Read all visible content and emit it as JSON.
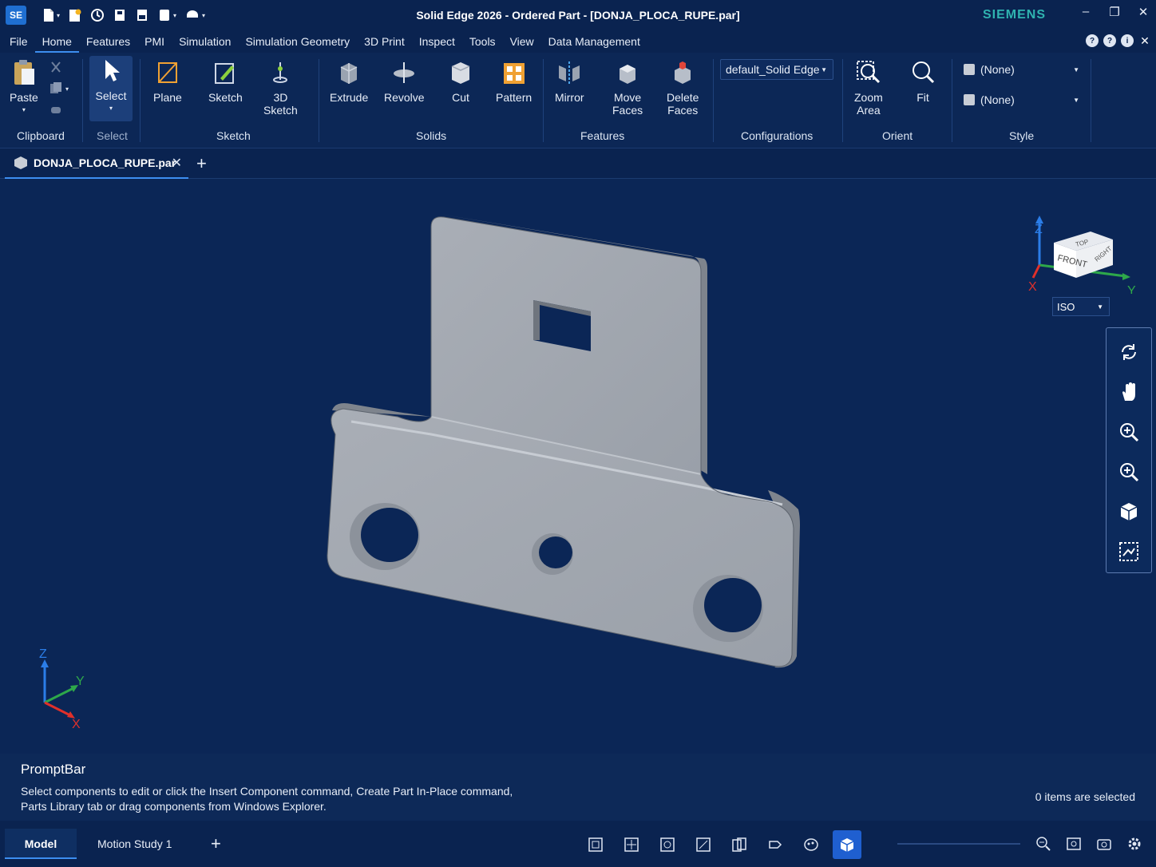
{
  "app": {
    "logo": "SE",
    "title": "Solid Edge 2026 - Ordered Part - [DONJA_PLOCA_RUPE.par]",
    "brand": "SIEMENS"
  },
  "quick_access": [
    "new-icon",
    "open-icon",
    "save-icon",
    "save-as-icon",
    "print-icon",
    "undo-icon",
    "redo-icon"
  ],
  "window_controls": {
    "minimize": "–",
    "restore": "❐",
    "close": "✕"
  },
  "menu": {
    "items": [
      "File",
      "Home",
      "Features",
      "PMI",
      "Simulation",
      "Simulation Geometry",
      "3D Print",
      "Inspect",
      "Tools",
      "View",
      "Data Management"
    ],
    "active": "Home"
  },
  "ribbon": {
    "paste": "Paste",
    "select": "Select",
    "plane": "Plane",
    "sketch": "Sketch",
    "sketch3d": "3D\nSketch",
    "extrude": "Extrude",
    "revolve": "Revolve",
    "cut": "Cut",
    "pattern": "Pattern",
    "mirror": "Mirror",
    "move_faces": "Move\nFaces",
    "delete_faces": "Delete\nFaces",
    "config_value": "default_Solid Edge",
    "zoom_area": "Zoom\nArea",
    "fit": "Fit",
    "style_1": "(None)",
    "style_2": "(None)",
    "groups": {
      "clipboard": "Clipboard",
      "select": "Select",
      "sketch": "Sketch",
      "solids": "Solids",
      "features": "Features",
      "configurations": "Configurations",
      "orient": "Orient",
      "style": "Style"
    }
  },
  "document_tab": {
    "label": "DONJA_PLOCA_RUPE.par",
    "close": "✕",
    "add": "+"
  },
  "viewport": {
    "viewcube": {
      "top": "TOP",
      "front": "FRONT",
      "right": "RIGHT"
    },
    "axes": {
      "x": "X",
      "y": "Y",
      "z": "Z"
    },
    "view_select": "ISO",
    "colors": {
      "background": "#0b2656",
      "part": "#a3a8b0",
      "x_axis": "#e0302a",
      "y_axis": "#2ea84a",
      "z_axis": "#2b7de8"
    }
  },
  "nav_tools": [
    "rotate-icon",
    "pan-icon",
    "zoom-in-icon",
    "zoom-icon",
    "view-cube-icon",
    "sketch-view-icon"
  ],
  "promptbar": {
    "title": "PromptBar",
    "message": "Select components to edit or click the Insert Component command, Create Part In-Place command, Parts Library tab or drag components from Windows Explorer.",
    "status": "0 items are selected"
  },
  "bottom": {
    "tabs": [
      "Model",
      "Motion Study 1"
    ],
    "active_tab": "Model",
    "add": "+"
  }
}
